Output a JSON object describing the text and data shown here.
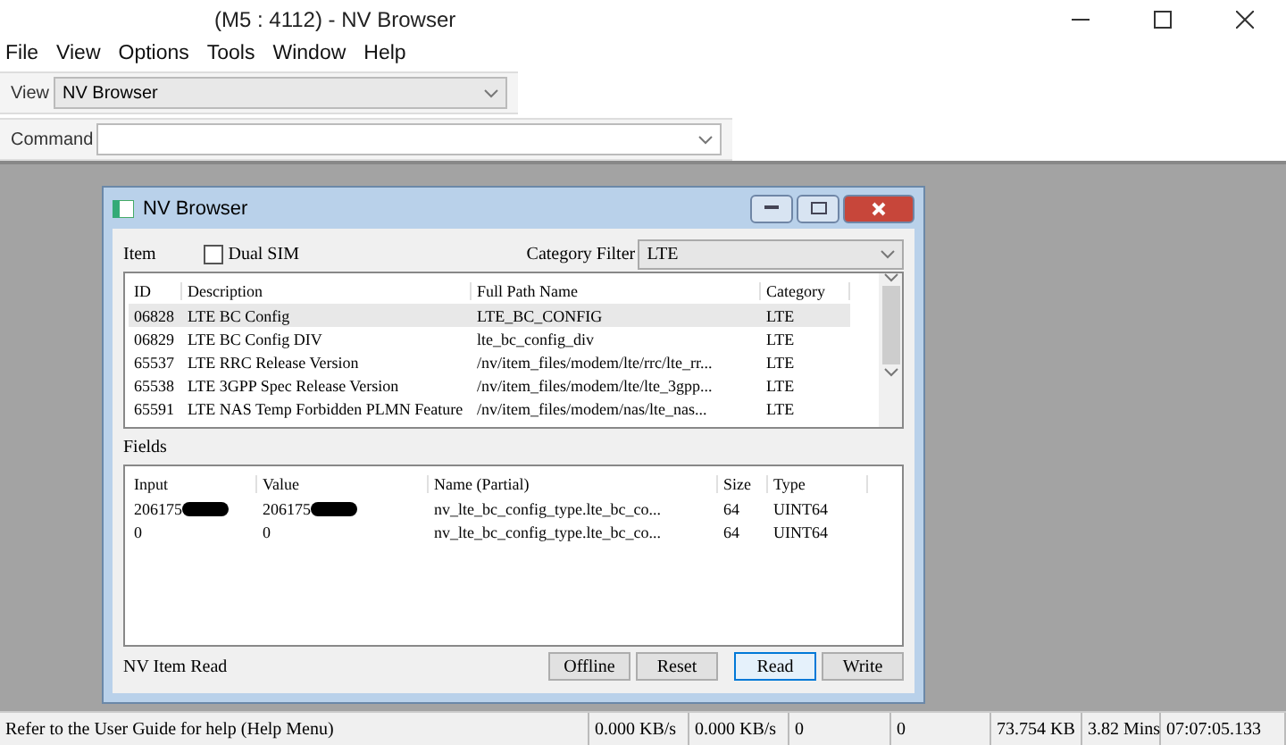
{
  "window": {
    "title": "(M5 : 4112) - NV Browser"
  },
  "menu": [
    "File",
    "View",
    "Options",
    "Tools",
    "Window",
    "Help"
  ],
  "view_bar": {
    "label": "View",
    "value": "NV Browser"
  },
  "command_bar": {
    "label": "Command"
  },
  "dialog": {
    "title": "NV Browser",
    "item_label": "Item",
    "dual_sim": {
      "label": "Dual SIM",
      "checked": false
    },
    "category_filter": {
      "label": "Category Filter",
      "value": "LTE"
    },
    "items": {
      "columns": [
        "ID",
        "Description",
        "Full Path Name",
        "Category"
      ],
      "rows": [
        {
          "cells": [
            "06828",
            "LTE BC Config",
            "LTE_BC_CONFIG",
            "LTE"
          ],
          "selected": true
        },
        {
          "cells": [
            "06829",
            "LTE BC Config DIV",
            "lte_bc_config_div",
            "LTE"
          ],
          "selected": false
        },
        {
          "cells": [
            "65537",
            "LTE RRC Release Version",
            "/nv/item_files/modem/lte/rrc/lte_rr...",
            "LTE"
          ],
          "selected": false
        },
        {
          "cells": [
            "65538",
            "LTE 3GPP Spec Release Version",
            "/nv/item_files/modem/lte/lte_3gpp...",
            "LTE"
          ],
          "selected": false
        },
        {
          "cells": [
            "65591",
            "LTE NAS Temp Forbidden PLMN Feature",
            "/nv/item_files/modem/nas/lte_nas...",
            "LTE"
          ],
          "selected": false
        }
      ]
    },
    "fields_label": "Fields",
    "fields": {
      "columns": [
        "Input",
        "Value",
        "Name (Partial)",
        "Size",
        "Type"
      ],
      "rows": [
        {
          "cells": [
            "206175",
            "206175",
            "nv_lte_bc_config_type.lte_bc_co...",
            "64",
            "UINT64"
          ],
          "redacted": true
        },
        {
          "cells": [
            "0",
            "0",
            "nv_lte_bc_config_type.lte_bc_co...",
            "64",
            "UINT64"
          ],
          "redacted": false
        }
      ]
    },
    "status": "NV Item Read",
    "buttons": [
      {
        "label": "Offline",
        "default": false
      },
      {
        "label": "Reset",
        "default": false
      },
      {
        "label": "Read",
        "default": true
      },
      {
        "label": "Write",
        "default": false
      }
    ]
  },
  "status_bar": [
    "Refer to the User Guide for help (Help Menu)",
    "0.000 KB/s",
    "0.000 KB/s",
    "0",
    "0",
    "73.754 KB",
    "3.82 Mins",
    "07:07:05.133"
  ]
}
